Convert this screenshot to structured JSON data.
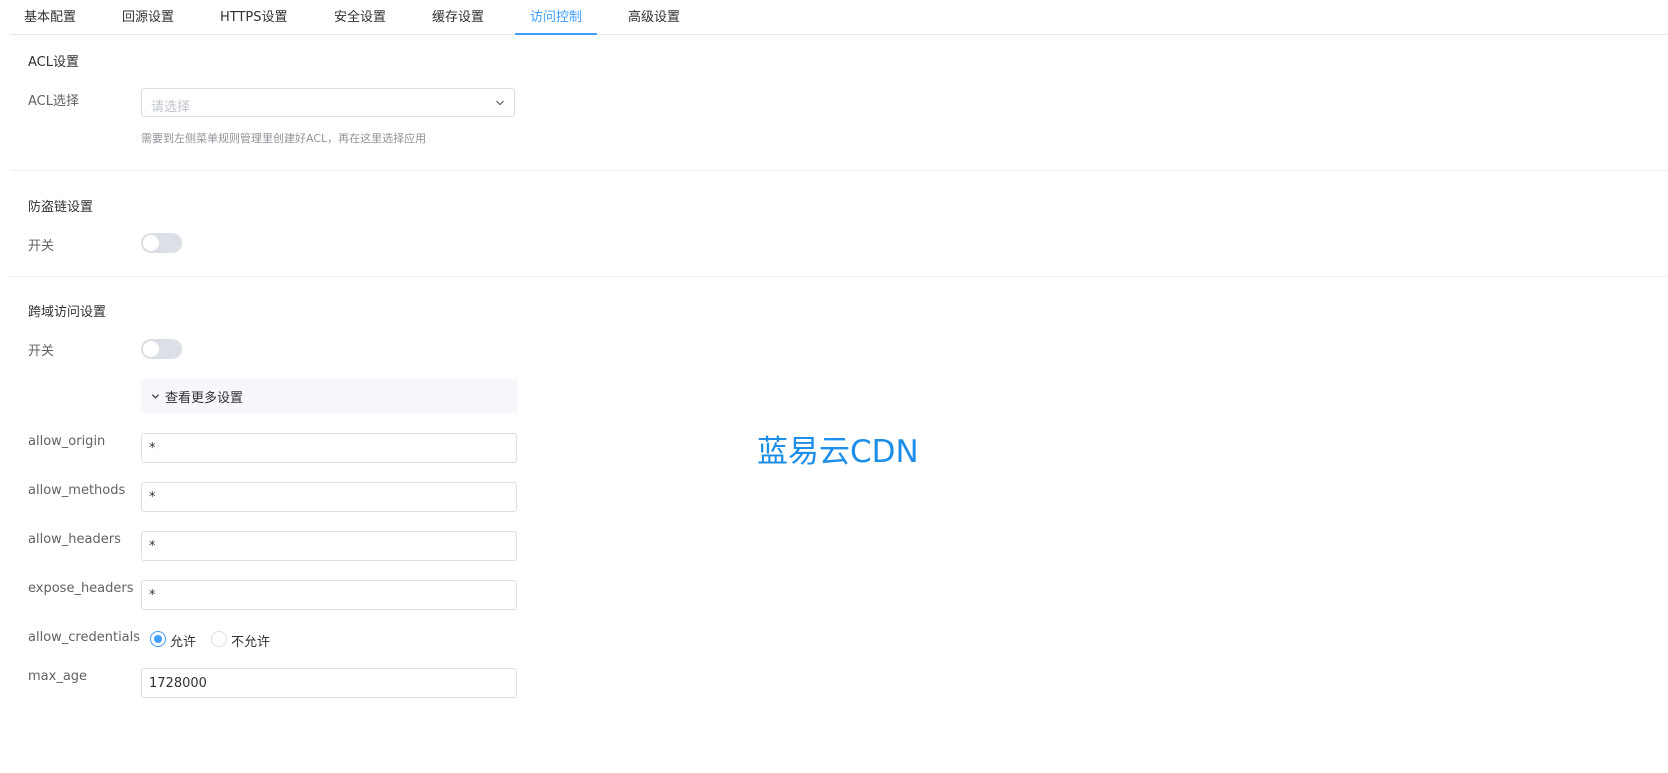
{
  "tabs": [
    {
      "label": "基本配置"
    },
    {
      "label": "回源设置"
    },
    {
      "label": "HTTPS设置"
    },
    {
      "label": "安全设置"
    },
    {
      "label": "缓存设置"
    },
    {
      "label": "访问控制",
      "active": true
    },
    {
      "label": "高级设置"
    }
  ],
  "acl": {
    "title": "ACL设置",
    "select_label": "ACL选择",
    "select_placeholder": "请选择",
    "hint": "需要到左侧菜单规则管理里创建好ACL，再在这里选择应用"
  },
  "hotlink": {
    "title": "防盗链设置",
    "switch_label": "开关",
    "enabled": false
  },
  "cors": {
    "title": "跨域访问设置",
    "switch_label": "开关",
    "enabled": false,
    "more_label": "查看更多设置",
    "allow_origin_label": "allow_origin",
    "allow_origin_value": "*",
    "allow_methods_label": "allow_methods",
    "allow_methods_value": "*",
    "allow_headers_label": "allow_headers",
    "allow_headers_value": "*",
    "expose_headers_label": "expose_headers",
    "expose_headers_value": "*",
    "allow_credentials_label": "allow_credentials",
    "credentials_options": [
      "允许",
      "不允许"
    ],
    "credentials_selected": "允许",
    "max_age_label": "max_age",
    "max_age_value": "1728000"
  },
  "watermark": "蓝易云CDN",
  "colors": {
    "accent": "#409eff",
    "watermark": "#1e8fe8"
  }
}
